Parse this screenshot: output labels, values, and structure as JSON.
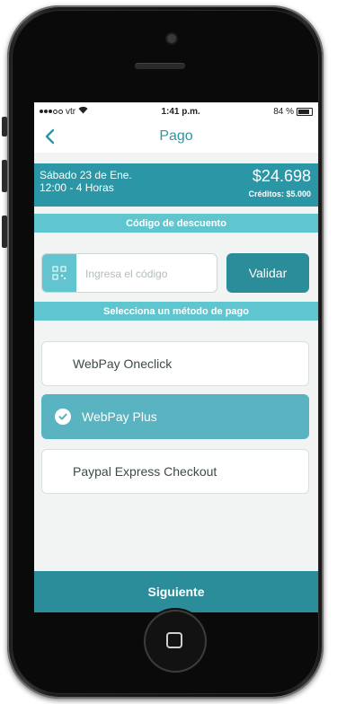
{
  "status_bar": {
    "carrier": "vtr",
    "time": "1:41 p.m.",
    "battery": "84 %",
    "battery_level": 0.84
  },
  "nav": {
    "title": "Pago"
  },
  "booking": {
    "date": "Sábado 23 de Ene.",
    "hours": "12:00 - 4 Horas",
    "price": "$24.698",
    "credits": "Créditos: $5.000"
  },
  "discount": {
    "header": "Código de descuento",
    "placeholder": "Ingresa el código",
    "value": "",
    "validate_label": "Validar"
  },
  "payment": {
    "header": "Selecciona un método de pago",
    "methods": [
      {
        "label": "WebPay Oneclick",
        "selected": false
      },
      {
        "label": "WebPay Plus",
        "selected": true
      },
      {
        "label": "Paypal Express Checkout",
        "selected": false
      }
    ]
  },
  "footer": {
    "next_label": "Siguiente"
  },
  "colors": {
    "primary": "#2b97a6",
    "accent": "#5fc6cf",
    "selected": "#5ab3c0",
    "button": "#2b8c9a"
  }
}
